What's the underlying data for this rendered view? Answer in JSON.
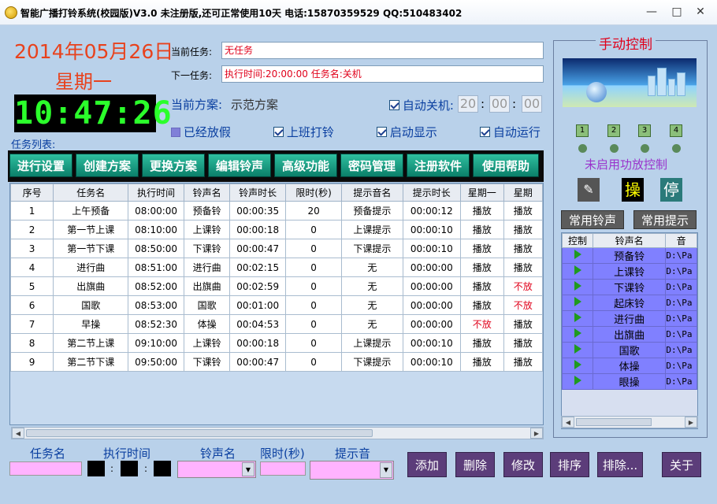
{
  "window": {
    "title": "智能广播打铃系统(校园版)V3.0 未注册版,还可正常使用10天 电话:15870359529 QQ:510483402"
  },
  "header": {
    "date": "2014年05月26日",
    "weekday": "星期一",
    "clock": "10:47:26",
    "current_task_label": "当前任务:",
    "current_task_value": "无任务",
    "next_task_label": "下一任务:",
    "next_task_value": "执行时间:20:00:00 任务名:关机",
    "scheme_label": "当前方案:",
    "scheme_value": "示范方案",
    "auto_shutdown_label": "自动关机:",
    "shutdown_h": "20",
    "shutdown_m": "00",
    "shutdown_s": "00",
    "opt_holiday": "已经放假",
    "opt_work_bell": "上班打铃",
    "opt_startup_show": "启动显示",
    "opt_autorun": "自动运行"
  },
  "tasklist_label": "任务列表:",
  "toolbar": {
    "buttons": [
      "进行设置",
      "创建方案",
      "更换方案",
      "编辑铃声",
      "高级功能",
      "密码管理",
      "注册软件",
      "使用帮助"
    ]
  },
  "table": {
    "headers": [
      "序号",
      "任务名",
      "执行时间",
      "铃声名",
      "铃声时长",
      "限时(秒)",
      "提示音名",
      "提示时长",
      "星期一",
      "星期"
    ],
    "rows": [
      [
        "1",
        "上午预备",
        "08:00:00",
        "预备铃",
        "00:00:35",
        "20",
        "预备提示",
        "00:00:12",
        "播放",
        "播放"
      ],
      [
        "2",
        "第一节上课",
        "08:10:00",
        "上课铃",
        "00:00:18",
        "0",
        "上课提示",
        "00:00:10",
        "播放",
        "播放"
      ],
      [
        "3",
        "第一节下课",
        "08:50:00",
        "下课铃",
        "00:00:47",
        "0",
        "下课提示",
        "00:00:10",
        "播放",
        "播放"
      ],
      [
        "4",
        "进行曲",
        "08:51:00",
        "进行曲",
        "00:02:15",
        "0",
        "无",
        "00:00:00",
        "播放",
        "播放"
      ],
      [
        "5",
        "出旗曲",
        "08:52:00",
        "出旗曲",
        "00:02:59",
        "0",
        "无",
        "00:00:00",
        "播放",
        "不放"
      ],
      [
        "6",
        "国歌",
        "08:53:00",
        "国歌",
        "00:01:00",
        "0",
        "无",
        "00:00:00",
        "播放",
        "不放"
      ],
      [
        "7",
        "早操",
        "08:52:30",
        "体操",
        "00:04:53",
        "0",
        "无",
        "00:00:00",
        "不放",
        "播放"
      ],
      [
        "8",
        "第二节上课",
        "09:10:00",
        "上课铃",
        "00:00:18",
        "0",
        "上课提示",
        "00:00:10",
        "播放",
        "播放"
      ],
      [
        "9",
        "第二节下课",
        "09:50:00",
        "下课铃",
        "00:00:47",
        "0",
        "下课提示",
        "00:00:10",
        "播放",
        "播放"
      ]
    ]
  },
  "form": {
    "task_name_label": "任务名",
    "exec_time_label": "执行时间",
    "ring_name_label": "铃声名",
    "limit_label": "限时(秒)",
    "tip_label": "提示音",
    "colon": ":"
  },
  "actions": [
    "添加",
    "删除",
    "修改",
    "排序",
    "排除...",
    "关于"
  ],
  "right_panel": {
    "title": "手动控制",
    "zones": [
      "1",
      "2",
      "3",
      "4"
    ],
    "amp_status": "未启用功放控制",
    "play_icon_label": "操",
    "stop_icon_label": "停",
    "common_ring_label": "常用铃声",
    "common_tip_label": "常用提示",
    "list_headers": [
      "控制",
      "铃声名",
      "音"
    ],
    "list_items": [
      {
        "name": "预备铃",
        "path": "D:\\Pa"
      },
      {
        "name": "上课铃",
        "path": "D:\\Pa"
      },
      {
        "name": "下课铃",
        "path": "D:\\Pa"
      },
      {
        "name": "起床铃",
        "path": "D:\\Pa"
      },
      {
        "name": "进行曲",
        "path": "D:\\Pa"
      },
      {
        "name": "出旗曲",
        "path": "D:\\Pa"
      },
      {
        "name": "国歌",
        "path": "D:\\Pa"
      },
      {
        "name": "体操",
        "path": "D:\\Pa"
      },
      {
        "name": "眼操",
        "path": "D:\\Pa"
      }
    ]
  }
}
